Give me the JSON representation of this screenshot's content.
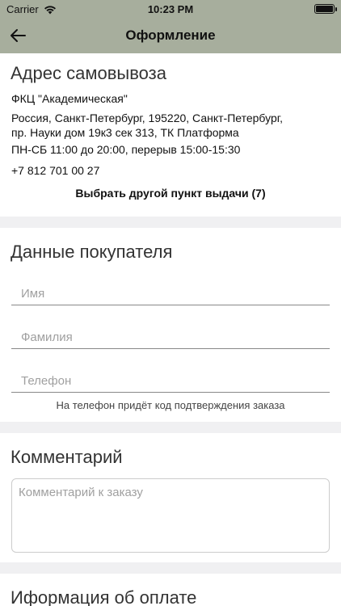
{
  "status_bar": {
    "carrier": "Carrier",
    "time": "10:23 PM"
  },
  "nav": {
    "title": "Оформление",
    "back_icon": "arrow-left-icon"
  },
  "pickup": {
    "heading": "Адрес самовывоза",
    "name": "ФКЦ \"Академическая\"",
    "address_line1": "Россия, Санкт-Петербург, 195220, Санкт-Петербург,",
    "address_line2": "пр. Науки дом 19к3 сек 313, ТК Платформа",
    "hours": "ПН-СБ 11:00 до 20:00, перерыв 15:00-15:30",
    "phone": "+7 812 701 00 27",
    "choose_other": "Выбрать другой пункт выдачи (7)"
  },
  "buyer": {
    "heading": "Данные покупателя",
    "first_name_placeholder": "Имя",
    "last_name_placeholder": "Фамилия",
    "phone_placeholder": "Телефон",
    "phone_hint": "На телефон придёт код подтверждения заказа"
  },
  "comment": {
    "heading": "Комментарий",
    "placeholder": "Комментарий к заказу"
  },
  "payment": {
    "heading": "Иформация об оплате"
  },
  "colors": {
    "nav_background": "#a7ae9d",
    "separator": "#f0f0f2"
  }
}
